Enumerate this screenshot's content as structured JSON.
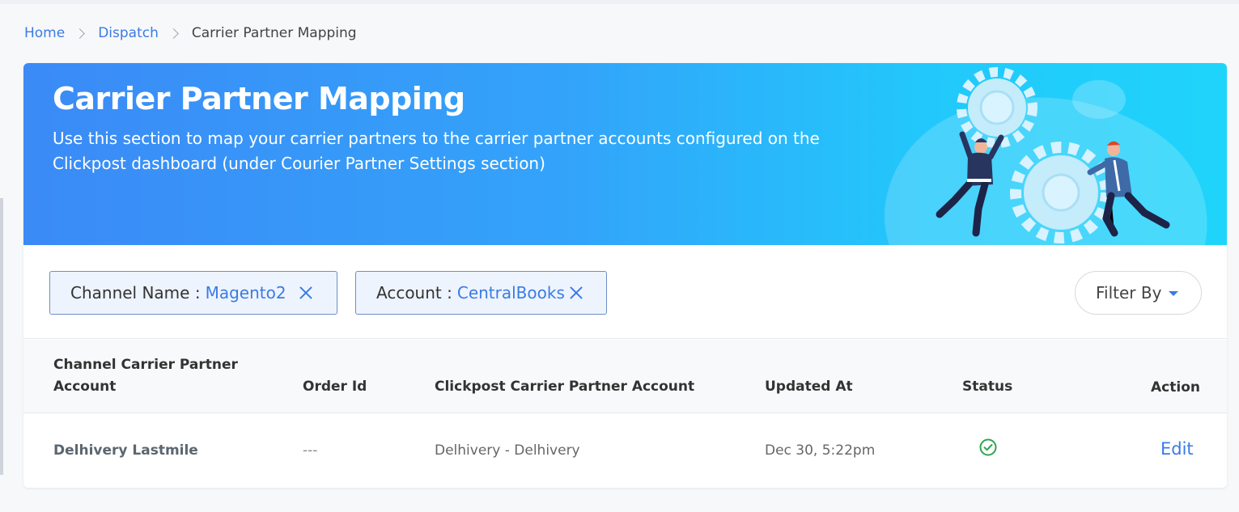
{
  "breadcrumb": {
    "home": "Home",
    "dispatch": "Dispatch",
    "current": "Carrier Partner Mapping"
  },
  "banner": {
    "title": "Carrier Partner Mapping",
    "description": "Use this section to map your carrier partners to the carrier partner accounts configured on the Clickpost dashboard (under Courier Partner Settings section)"
  },
  "filters": {
    "chips": [
      {
        "label": "Channel Name :",
        "value": "Magento2"
      },
      {
        "label": "Account :",
        "value": "CentralBooks"
      }
    ],
    "filter_by_label": "Filter By"
  },
  "table": {
    "headers": [
      "Channel Carrier Partner Account",
      "Order Id",
      "Clickpost Carrier Partner Account",
      "Updated At",
      "Status",
      "Action"
    ],
    "rows": [
      {
        "channel_account": "Delhivery Lastmile",
        "order_id": "---",
        "clickpost_account": "Delhivery - Delhivery",
        "updated_at": "Dec 30, 5:22pm",
        "status": "check-circle-icon",
        "action": "Edit"
      }
    ]
  },
  "colors": {
    "accent": "#3a7be6",
    "status_ok": "#2ea44f",
    "banner_start": "#3b8af6",
    "banner_end": "#1fd4fb"
  }
}
